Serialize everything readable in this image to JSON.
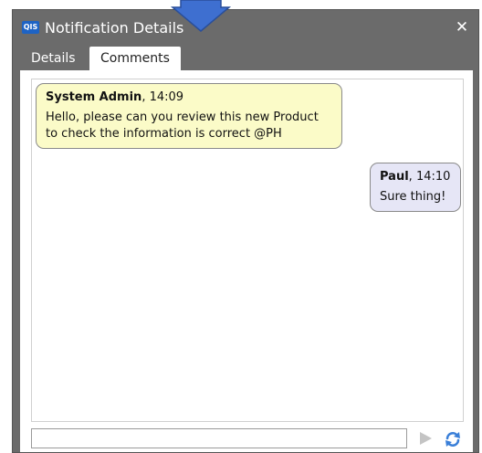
{
  "window": {
    "logo_text": "QIS",
    "title": "Notification Details",
    "close_symbol": "✕"
  },
  "tabs": [
    {
      "label": "Details",
      "active": false
    },
    {
      "label": "Comments",
      "active": true
    }
  ],
  "comments": [
    {
      "author": "System Admin",
      "separator": ", ",
      "time": "14:09",
      "text": "Hello, please can you review this new Product to check the information is correct @PH"
    },
    {
      "author": "Paul",
      "separator": ", ",
      "time": "14:10",
      "text": "Sure thing!"
    }
  ],
  "composer": {
    "value": "",
    "placeholder": "",
    "send_icon": "send-icon",
    "refresh_icon": "refresh-icon"
  },
  "colors": {
    "titlebar": "#6b6b6b",
    "pointer_arrow": "#3e6fd0",
    "left_bubble": "#fbfbc8",
    "right_bubble": "#e6e6f6",
    "refresh": "#3a7fd8",
    "send": "#c4c4c4"
  }
}
